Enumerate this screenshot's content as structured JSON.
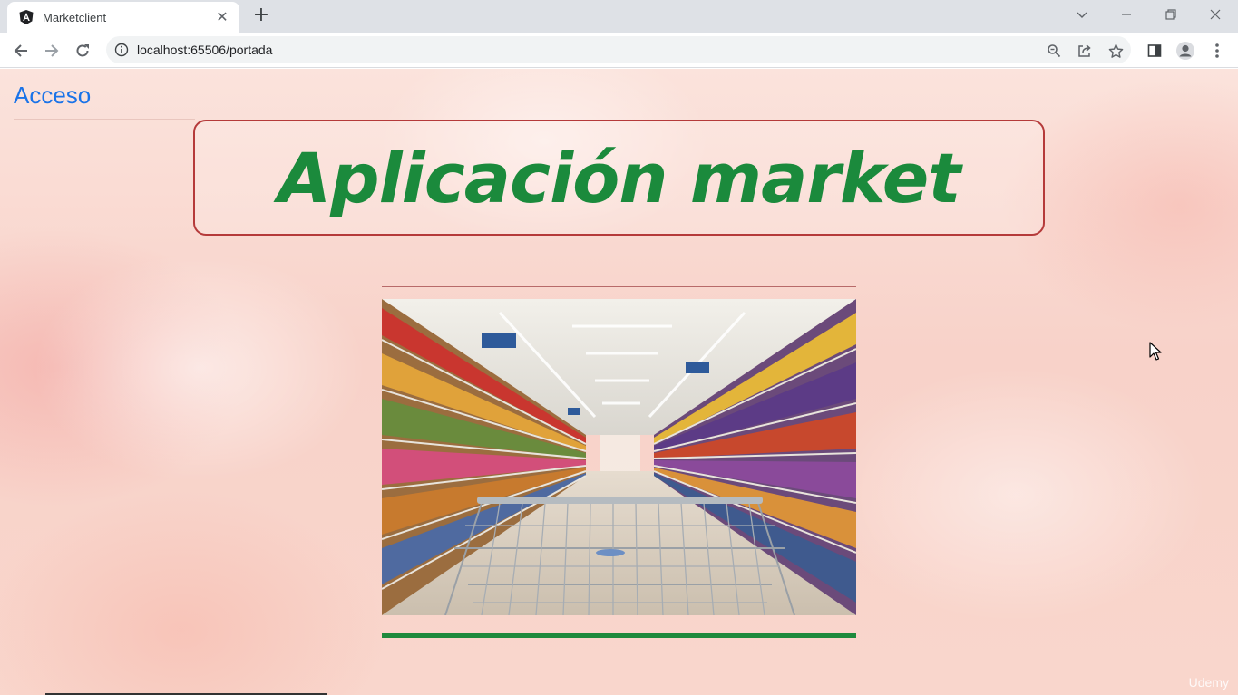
{
  "browser": {
    "tab_title": "Marketclient",
    "tab_close": "✕",
    "new_tab": "+",
    "url": "localhost:65506/portada"
  },
  "page": {
    "nav_link": "Acceso",
    "heading": "Aplicación market",
    "watermark": "Udemy"
  },
  "colors": {
    "heading": "#1b8a3c",
    "title_border": "#b53a3a",
    "link": "#1a73e8",
    "bottom_rule": "#1e8a3d"
  },
  "icons": [
    "angular-favicon-icon",
    "back-icon",
    "forward-icon",
    "reload-icon",
    "info-icon",
    "zoom-icon",
    "share-icon",
    "star-icon",
    "side-panel-icon",
    "profile-icon",
    "menu-icon",
    "tab-search-icon",
    "minimize-icon",
    "restore-icon",
    "close-icon"
  ]
}
